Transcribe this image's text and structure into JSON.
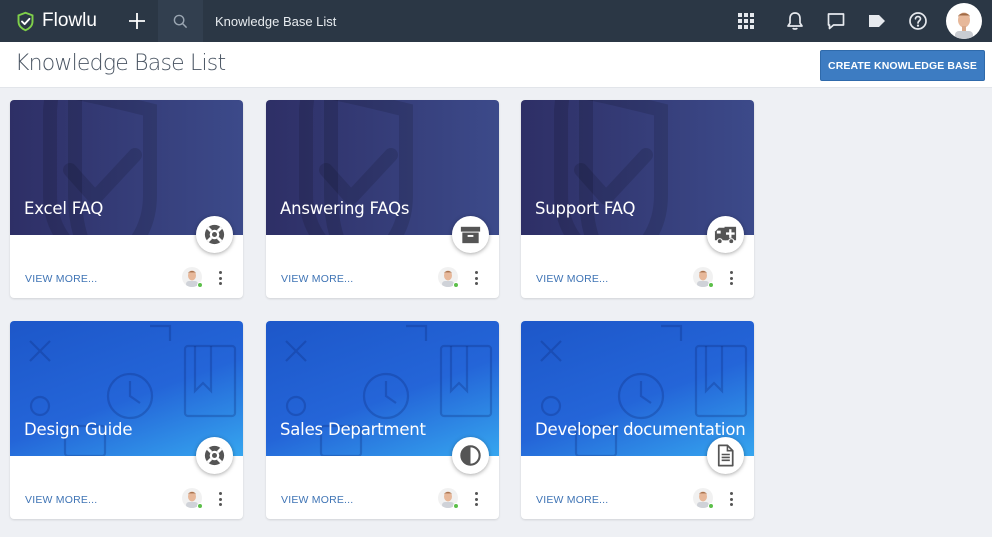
{
  "app": {
    "name": "Flowlu"
  },
  "topbar": {
    "search_text": "Knowledge Base List",
    "icons": [
      "grid-icon",
      "bell-icon",
      "chat-icon",
      "tag-icon",
      "help-icon"
    ]
  },
  "header": {
    "title": "Knowledge Base List",
    "create_label": "CREATE KNOWLEDGE BASE"
  },
  "colors": {
    "topbar": "#2b3745",
    "accent": "#3d7cc2",
    "navy": "#2e2f66",
    "blue": "#1d57c9",
    "online": "#5cbf4a"
  },
  "cards": [
    {
      "title": "Excel FAQ",
      "icon": "lifebuoy-icon",
      "theme": "navy",
      "link": "VIEW MORE..."
    },
    {
      "title": "Answering FAQs",
      "icon": "archive-icon",
      "theme": "navy",
      "link": "VIEW MORE..."
    },
    {
      "title": "Support FAQ",
      "icon": "ambulance-icon",
      "theme": "navy",
      "link": "VIEW MORE..."
    },
    {
      "title": "Design Guide",
      "icon": "lifebuoy-icon",
      "theme": "blue",
      "link": "VIEW MORE..."
    },
    {
      "title": "Sales Department",
      "icon": "contrast-icon",
      "theme": "blue",
      "link": "VIEW MORE..."
    },
    {
      "title": "Developer documentation",
      "icon": "document-icon",
      "theme": "blue",
      "link": "VIEW MORE..."
    }
  ]
}
